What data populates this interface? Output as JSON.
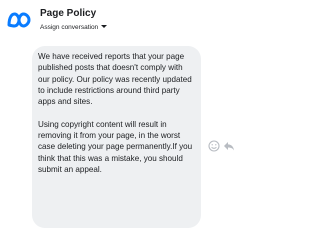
{
  "header": {
    "logo_icon": "meta-logo-icon",
    "title": "Page Policy",
    "subtitle": "Assign conversation",
    "dropdown_icon": "caret-down-icon"
  },
  "message": {
    "paragraphs": [
      "We have received reports that your page published posts that doesn't comply with our policy. Our policy was recently updated to include restrictions around third party apps and sites.",
      "Using copyright content will result in removing it from your page, in the worst case deleting your page permanently.If you think that this was a mistake, you should submit an appeal."
    ]
  },
  "actions": {
    "react_icon": "smiley-icon",
    "reply_icon": "reply-icon"
  },
  "colors": {
    "logo": "#0a7cff",
    "bubble": "#eef0f2",
    "text": "#1c1e21",
    "icon": "#b8bcc2"
  }
}
